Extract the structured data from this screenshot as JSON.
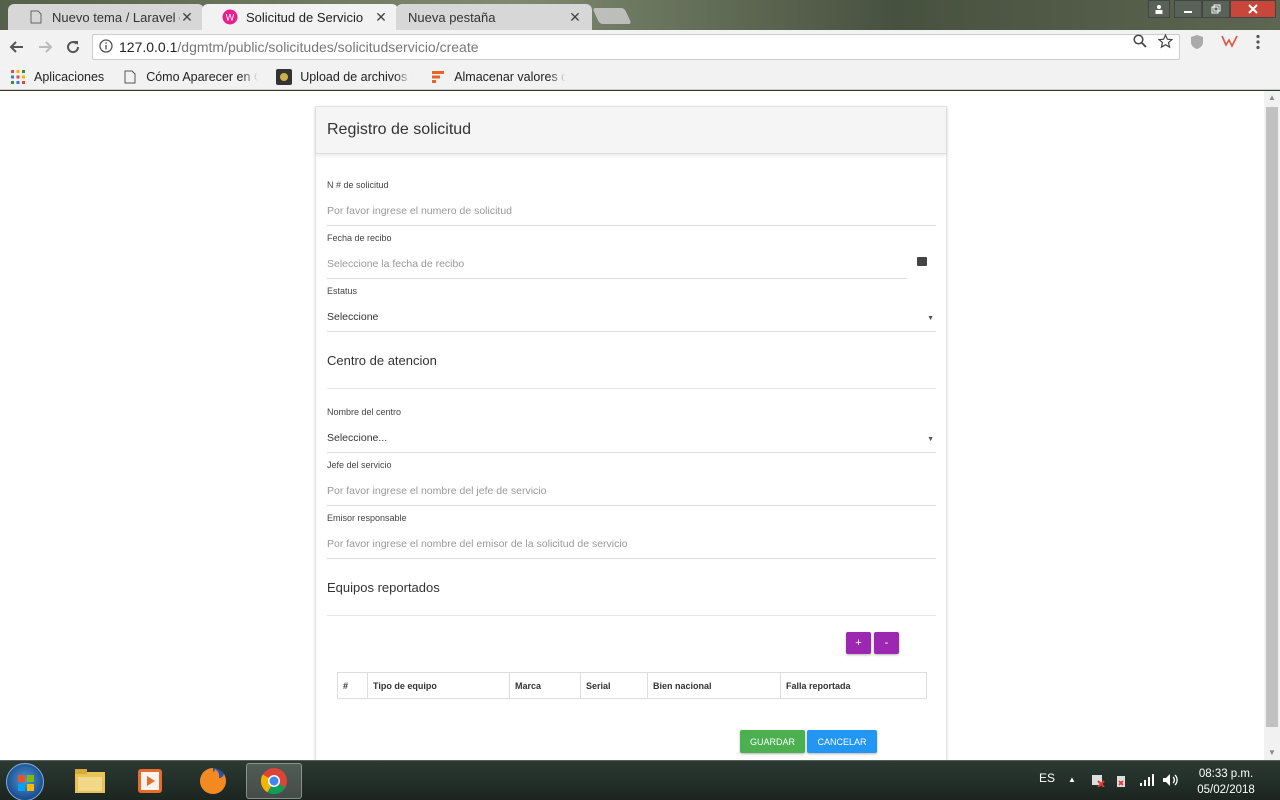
{
  "browser": {
    "tabs": [
      {
        "label": "Nuevo tema / Laravel en",
        "close": "✕"
      },
      {
        "label": "Solicitud de Servicio",
        "close": "✕"
      },
      {
        "label": "Nueva pestaña",
        "close": "✕"
      }
    ],
    "url_host": "127.0.0.1",
    "url_path": "/dgmtm/public/solicitudes/solicitudservicio/create",
    "bookmarks": [
      {
        "label": "Aplicaciones"
      },
      {
        "label": "Cómo Aparecer en G"
      },
      {
        "label": "Upload de archivos p"
      },
      {
        "label": "Almacenar valores de"
      }
    ]
  },
  "form": {
    "title": "Registro de solicitud",
    "fields": {
      "numero": {
        "label": "N # de solicitud",
        "placeholder": "Por favor ingrese el numero de solicitud"
      },
      "fecha": {
        "label": "Fecha de recibo",
        "placeholder": "Seleccione la fecha de recibo"
      },
      "estatus": {
        "label": "Estatus",
        "value": "Seleccione"
      },
      "centro": {
        "label": "Nombre del centro",
        "value": "Seleccione..."
      },
      "jefe": {
        "label": "Jefe del servicio",
        "placeholder": "Por favor ingrese el nombre del jefe de servicio"
      },
      "emisor": {
        "label": "Emisor responsable",
        "placeholder": "Por favor ingrese el nombre del emisor de la solicitud de servicio"
      }
    },
    "sections": {
      "centro_title": "Centro de atencion",
      "equipos_title": "Equipos reportados"
    },
    "add_label": "+",
    "remove_label": "-",
    "table_headers": [
      "#",
      "Tipo de equipo",
      "Marca",
      "Serial",
      "Bien nacional",
      "Falla reportada"
    ],
    "save_label": "GUARDAR",
    "cancel_label": "CANCELAR"
  },
  "taskbar": {
    "language": "ES",
    "time": "08:33 p.m.",
    "date": "05/02/2018"
  },
  "colors": {
    "purple": "#9c27b0",
    "green": "#4caf50",
    "blue": "#2196f3"
  }
}
